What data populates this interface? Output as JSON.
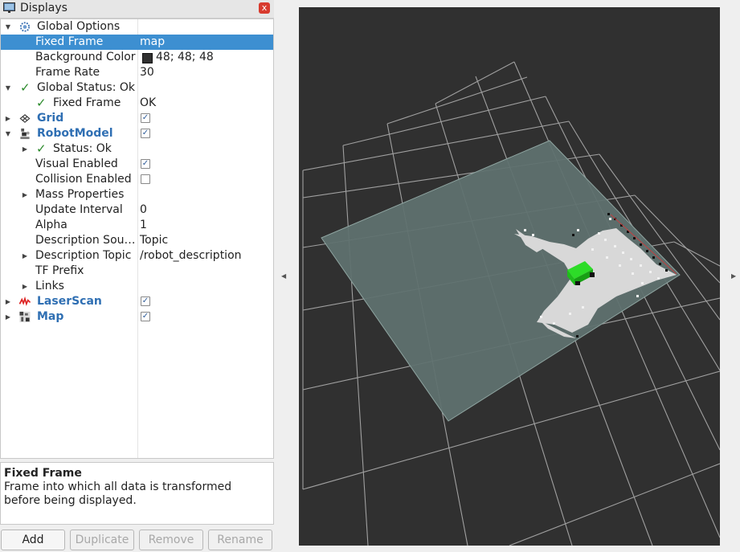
{
  "panel": {
    "title": "Displays",
    "close_label": "x"
  },
  "tree": {
    "rows": [
      {
        "label": "Global Options",
        "value": ""
      },
      {
        "label": "Fixed Frame",
        "value": "map"
      },
      {
        "label": "Background Color",
        "value": "48; 48; 48"
      },
      {
        "label": "Frame Rate",
        "value": "30"
      },
      {
        "label": "Global Status: Ok",
        "value": ""
      },
      {
        "label": "Fixed Frame",
        "value": "OK"
      },
      {
        "label": "Grid",
        "value": "",
        "checked": true
      },
      {
        "label": "RobotModel",
        "value": "",
        "checked": true
      },
      {
        "label": "Status: Ok",
        "value": ""
      },
      {
        "label": "Visual Enabled",
        "value": "",
        "checked": true
      },
      {
        "label": "Collision Enabled",
        "value": "",
        "checked": false
      },
      {
        "label": "Mass Properties",
        "value": ""
      },
      {
        "label": "Update Interval",
        "value": "0"
      },
      {
        "label": "Alpha",
        "value": "1"
      },
      {
        "label": "Description Sou…",
        "value": "Topic"
      },
      {
        "label": "Description Topic",
        "value": "/robot_description"
      },
      {
        "label": "TF Prefix",
        "value": ""
      },
      {
        "label": "Links",
        "value": ""
      },
      {
        "label": "LaserScan",
        "value": "",
        "checked": true
      },
      {
        "label": "Map",
        "value": "",
        "checked": true
      }
    ]
  },
  "description": {
    "title": "Fixed Frame",
    "text": "Frame into which all data is transformed before being displayed."
  },
  "buttons": {
    "add": "Add",
    "duplicate": "Duplicate",
    "remove": "Remove",
    "rename": "Rename"
  },
  "colors": {
    "selection": "#3d8fd1",
    "display_name": "#2f6fb3",
    "status_ok": "#2a8a2a",
    "viewport_background": "#303030",
    "map_plane": "#5f716e",
    "scan_points": "#d8d8d8",
    "robot": "#22c01e"
  },
  "icons": {
    "panel": "monitor-icon",
    "global_options": "gear-icon",
    "grid": "grid-icon",
    "robot_model": "robot-icon",
    "laser_scan": "laser-scan-icon",
    "map": "map-icon",
    "status_ok": "checkmark-icon",
    "expand": "triangle-right-icon",
    "collapse": "triangle-down-icon"
  }
}
